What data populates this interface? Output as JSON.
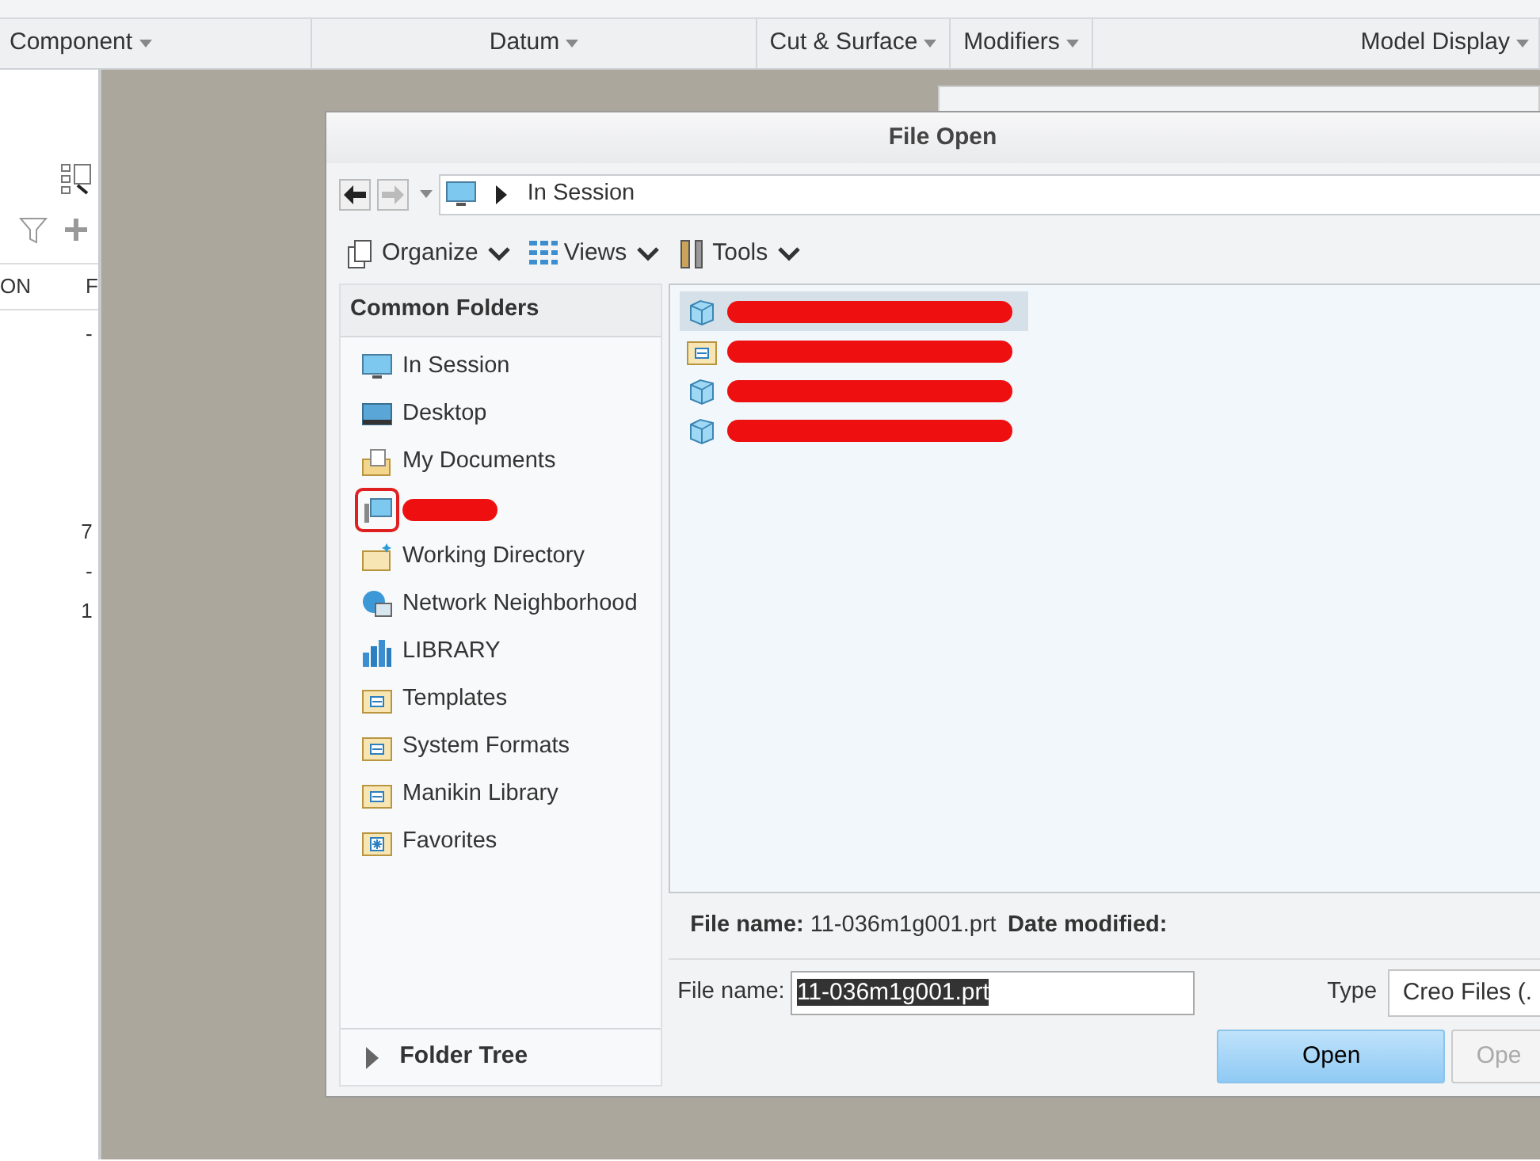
{
  "ribbon": {
    "groups": [
      {
        "label": "Component"
      },
      {
        "label": "Datum"
      },
      {
        "label": "Cut & Surface"
      },
      {
        "label": "Modifiers"
      },
      {
        "label": "Model Display"
      }
    ]
  },
  "model_tree": {
    "columns": [
      {
        "label": "ON"
      },
      {
        "label": "F"
      }
    ],
    "rows": [
      {
        "value": "-"
      },
      {
        "value": "7"
      },
      {
        "value": "-"
      },
      {
        "value": "1"
      }
    ]
  },
  "dialog": {
    "title": "File Open",
    "address": {
      "path": "In Session"
    },
    "toolbar": [
      {
        "label": "Organize",
        "kind": "organize"
      },
      {
        "label": "Views",
        "kind": "views"
      },
      {
        "label": "Tools",
        "kind": "tools"
      }
    ],
    "common_folders": {
      "heading": "Common Folders",
      "items": [
        {
          "label": "In Session",
          "kind": "session",
          "redacted": false,
          "highlighted": false
        },
        {
          "label": "Desktop",
          "kind": "desktop",
          "redacted": false,
          "highlighted": false
        },
        {
          "label": "My Documents",
          "kind": "documents",
          "redacted": false,
          "highlighted": false
        },
        {
          "kind": "computer",
          "redacted": true,
          "highlighted": true
        },
        {
          "label": "Working Directory",
          "kind": "workdir",
          "redacted": false,
          "highlighted": false
        },
        {
          "label": "Network Neighborhood",
          "kind": "network",
          "redacted": false,
          "highlighted": false
        },
        {
          "label": "LIBRARY",
          "kind": "library",
          "redacted": false,
          "highlighted": false
        },
        {
          "label": "Templates",
          "kind": "folder",
          "redacted": false,
          "highlighted": false
        },
        {
          "label": "System Formats",
          "kind": "folder",
          "redacted": false,
          "highlighted": false
        },
        {
          "label": "Manikin Library",
          "kind": "folder",
          "redacted": false,
          "highlighted": false
        },
        {
          "label": "Favorites",
          "kind": "favorites",
          "redacted": false,
          "highlighted": false
        }
      ]
    },
    "folder_tree": {
      "label": "Folder Tree",
      "expanded": false
    },
    "files": [
      {
        "kind": "part",
        "selected": true,
        "redacted": true
      },
      {
        "kind": "folder",
        "selected": false,
        "redacted": true
      },
      {
        "kind": "part",
        "selected": false,
        "redacted": true
      },
      {
        "kind": "part",
        "selected": false,
        "redacted": true
      }
    ],
    "details": {
      "name_label": "File name:",
      "name_value": "11-036m1g001.prt",
      "date_label": "Date modified:"
    },
    "file_name": {
      "label": "File name:",
      "value": "11-036m1g001.prt"
    },
    "type": {
      "label": "Type",
      "value": "Creo Files (."
    },
    "buttons": [
      {
        "label": "Open",
        "kind": "primary"
      },
      {
        "label": "Ope",
        "kind": "secondary"
      }
    ]
  }
}
